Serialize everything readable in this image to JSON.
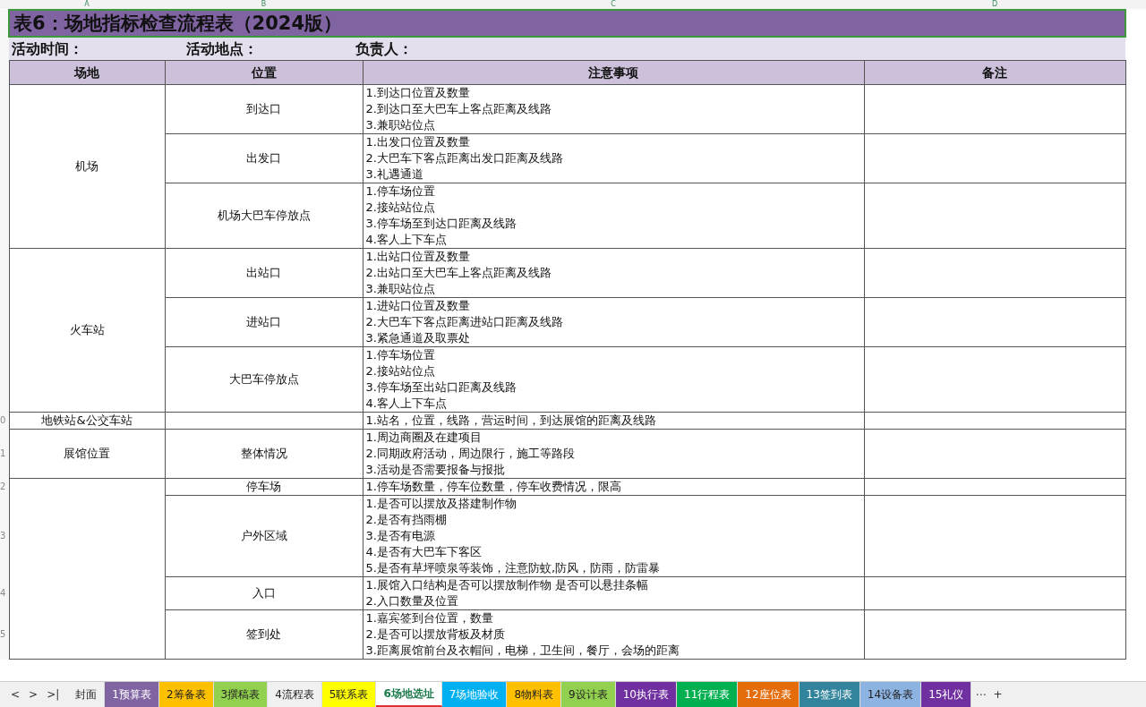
{
  "column_letters": [
    "A",
    "B",
    "C",
    "D"
  ],
  "title": "表6：场地指标检查流程表（2024版）",
  "info": [
    "活动时间：",
    "活动地点：",
    "负责人："
  ],
  "table": {
    "columns": [
      "场地",
      "位置",
      "注意事项",
      "备注"
    ],
    "groups": [
      {
        "venue": "机场",
        "rows": [
          {
            "location": "到达口",
            "notes": [
              "1.到达口位置及数量",
              "2.到达口至大巴车上客点距离及线路",
              "3.兼职站位点"
            ]
          },
          {
            "location": "出发口",
            "notes": [
              "1.出发口位置及数量",
              "2.大巴车下客点距离出发口距离及线路",
              "3.礼遇通道"
            ]
          },
          {
            "location": "机场大巴车停放点",
            "notes": [
              "1.停车场位置",
              "2.接站站位点",
              "3.停车场至到达口距离及线路",
              "4.客人上下车点"
            ]
          }
        ]
      },
      {
        "venue": "火车站",
        "rows": [
          {
            "location": "出站口",
            "notes": [
              "1.出站口位置及数量",
              "2.出站口至大巴车上客点距离及线路",
              "3.兼职站位点"
            ]
          },
          {
            "location": "进站口",
            "notes": [
              "1.进站口位置及数量",
              "2.大巴车下客点距离进站口距离及线路",
              "3.紧急通道及取票处"
            ]
          },
          {
            "location": "大巴车停放点",
            "notes": [
              "1.停车场位置",
              "2.接站站位点",
              "3.停车场至出站口距离及线路",
              "4.客人上下车点"
            ]
          }
        ]
      },
      {
        "venue": "地铁站&公交车站",
        "rows": [
          {
            "row_number": "0",
            "notes": [
              "1.站名，位置，线路，营运时间，到达展馆的距离及线路"
            ]
          }
        ]
      },
      {
        "venue": "展馆位置",
        "rows": [
          {
            "row_number": "1",
            "location": "整体情况",
            "notes": [
              "1.周边商圈及在建项目",
              "2.同期政府活动，周边限行，施工等路段",
              "3.活动是否需要报备与报批"
            ]
          }
        ]
      },
      {
        "rows": [
          {
            "row_number": "2",
            "location": "停车场",
            "notes": [
              "1.停车场数量，停车位数量，停车收费情况，限高"
            ]
          },
          {
            "row_number": "3",
            "location": "户外区域",
            "notes": [
              "1.是否可以摆放及搭建制作物",
              "2.是否有挡雨棚",
              "3.是否有电源",
              "4.是否有大巴车下客区",
              "5.是否有草坪喷泉等装饰，注意防蚊,防风，防雨，防雷暴"
            ]
          },
          {
            "row_number": "4",
            "location": "入口",
            "notes": [
              "1.展馆入口结构是否可以摆放制作物 是否可以悬挂条幅",
              "2.入口数量及位置"
            ]
          },
          {
            "row_number": "5",
            "location": "签到处",
            "notes": [
              "1.嘉宾签到台位置，数量",
              "2.是否可以摆放背板及材质",
              "3.距离展馆前台及衣帽间，电梯，卫生间，餐厅，会场的距离"
            ]
          }
        ]
      }
    ]
  },
  "sheet_nav": [
    "<",
    ">",
    ">|"
  ],
  "sheet_tabs": [
    {
      "label": "封面",
      "selected": false
    },
    {
      "label": "1预算表",
      "selected": false,
      "color": "#8064a2"
    },
    {
      "label": "2筹备表",
      "selected": false,
      "color": "#ffc000"
    },
    {
      "label": "3撰稿表",
      "selected": false,
      "color": "#92d050"
    },
    {
      "label": "4流程表",
      "selected": false
    },
    {
      "label": "5联系表",
      "selected": false,
      "color": "#ffff00"
    },
    {
      "label": "6场地选址",
      "selected": true
    },
    {
      "label": "7场地验收",
      "selected": false,
      "color": "#00b0f0"
    },
    {
      "label": "8物料表",
      "selected": false,
      "color": "#ffc000"
    },
    {
      "label": "9设计表",
      "selected": false,
      "color": "#92d050"
    },
    {
      "label": "10执行表",
      "selected": false,
      "color": "#7030a0"
    },
    {
      "label": "11行程表",
      "selected": false,
      "color": "#00b050"
    },
    {
      "label": "12座位表",
      "selected": false,
      "color": "#e46c0a"
    },
    {
      "label": "13签到表",
      "selected": false,
      "color": "#31849b"
    },
    {
      "label": "14设备表",
      "selected": false,
      "color": "#8db3e2"
    },
    {
      "label": "15礼仪",
      "selected": false,
      "color": "#7030a0"
    }
  ],
  "sheet_actions": [
    "⋯",
    "+"
  ]
}
